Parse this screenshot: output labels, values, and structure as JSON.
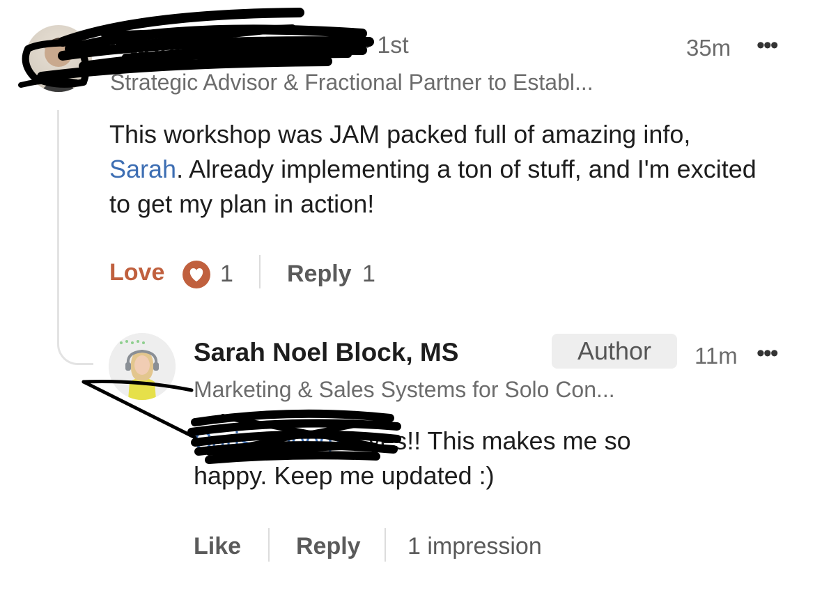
{
  "parent_comment": {
    "author_name": "Carisa Deegan",
    "connection_degree": "• 1st",
    "time": "35m",
    "menu_icon": "•••",
    "headline": "Strategic Advisor & Fractional Partner to Establ...",
    "text_before_mention": "This workshop was JAM packed full of amazing info, ",
    "mention": "Sarah",
    "text_after_mention": ". Already implementing a ton of stuff, and I'm excited to get my plan in action!",
    "reaction_label": "Love",
    "reaction_count": "1",
    "reply_label": "Reply",
    "reply_count": "1"
  },
  "reply_comment": {
    "author_name": "Sarah Noel Block, MS",
    "badge": "Author",
    "time": "11m",
    "menu_icon": "•••",
    "headline": "Marketing & Sales Systems for Solo Con...",
    "mention": "Carisa Deegan",
    "text_line1": " yes!! This makes me so",
    "text_line2": "happy. Keep me updated :)",
    "like_label": "Like",
    "reply_label": "Reply",
    "impressions": "1 impression"
  },
  "colors": {
    "love_accent": "#c0603e",
    "mention_link": "#3d6eb3",
    "muted_text": "#6c6c6c"
  }
}
